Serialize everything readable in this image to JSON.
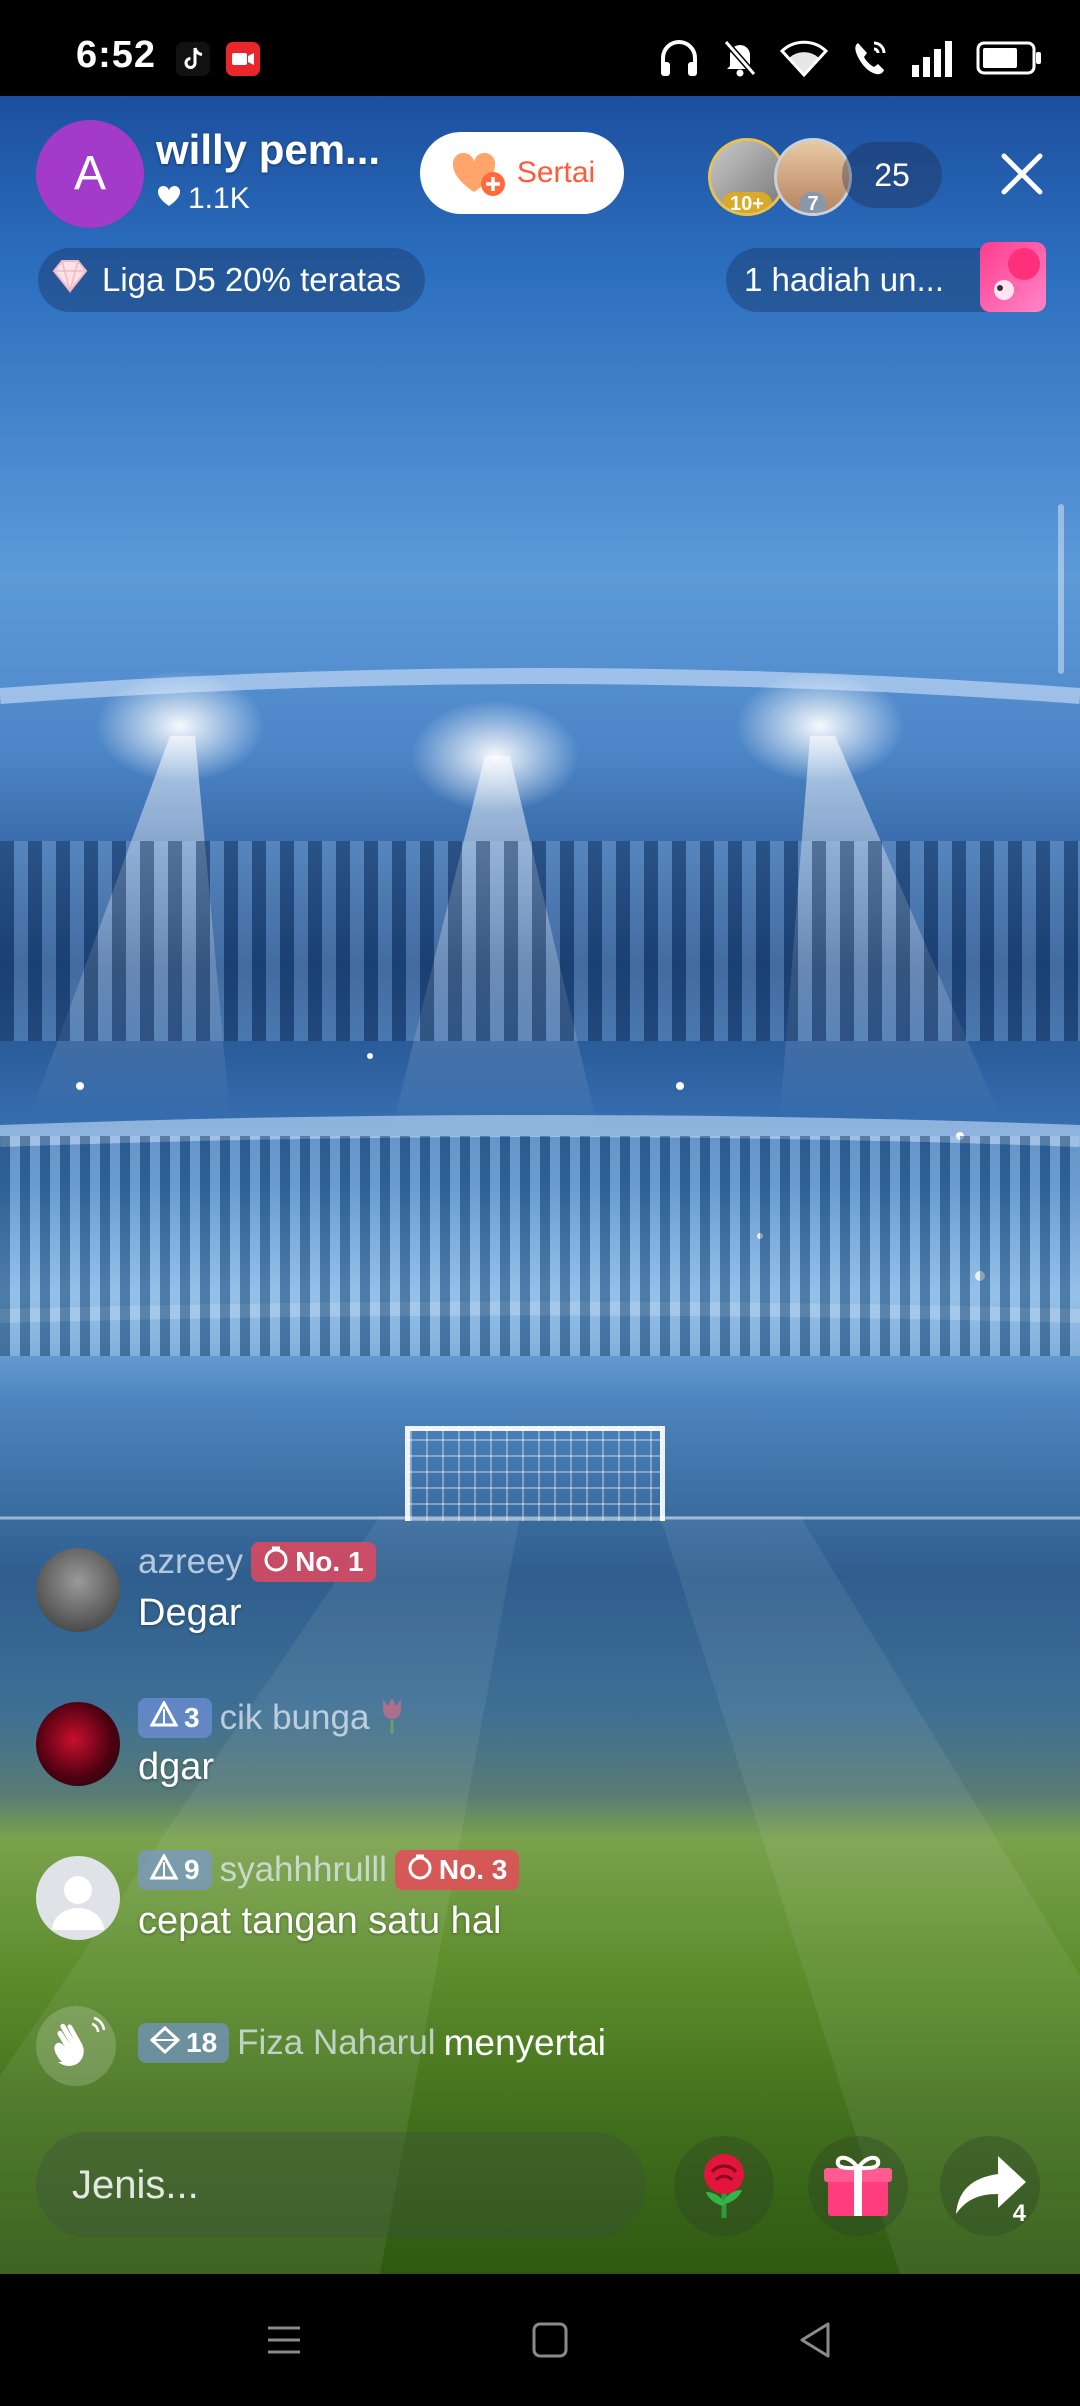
{
  "status_bar": {
    "time": "6:52"
  },
  "live": {
    "host_initial": "A",
    "host_name": "willy pem...",
    "host_likes": "1.1K",
    "follow_label": "Sertai",
    "viewer_badges": [
      "10+",
      "7"
    ],
    "viewer_count": "25",
    "league_label": "Liga D5 20% teratas",
    "gift_label": "1 hadiah un..."
  },
  "comments": [
    {
      "username": "azreey",
      "rank": "No. 1",
      "message": "Degar"
    },
    {
      "level": "3",
      "username": "cik bunga",
      "message": "dgar"
    },
    {
      "level": "9",
      "username": "syahhhrulll",
      "rank": "No. 3",
      "message": "cepat tangan satu hal"
    }
  ],
  "join_event": {
    "level": "18",
    "username": "Fiza Naharul",
    "action": "menyertai"
  },
  "bottom_bar": {
    "input_placeholder": "Jenis...",
    "share_count": "4"
  },
  "colors": {
    "host_avatar": "#a43ac9",
    "follow_text": "#ff5a3d",
    "rank_badge": "#ec465a",
    "level_badge": "#7896e6"
  }
}
